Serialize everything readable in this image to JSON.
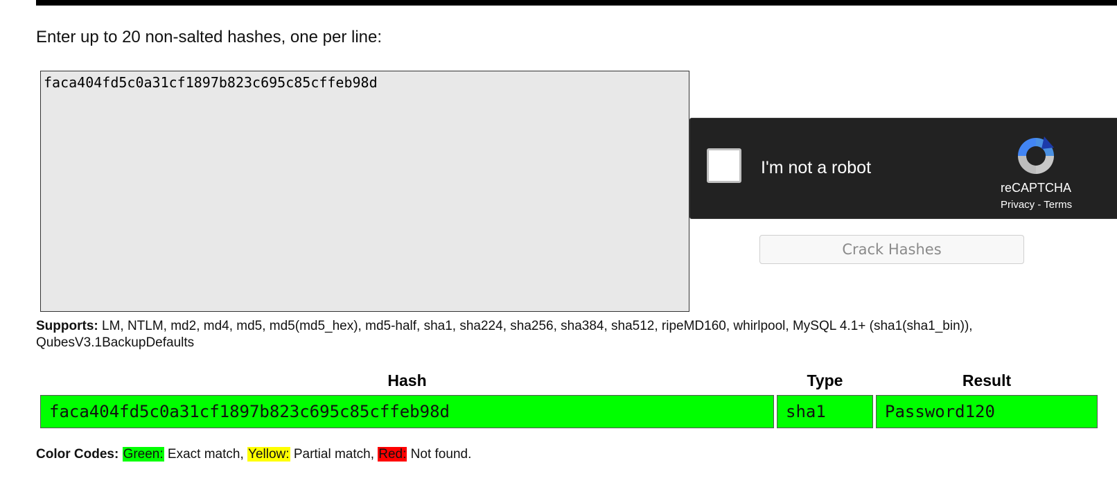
{
  "instructions": "Enter up to 20 non-salted hashes, one per line:",
  "hash_input": {
    "value": "faca404fd5c0a31cf1897b823c695c85cffeb98d"
  },
  "recaptcha": {
    "label": "I'm not a robot",
    "brand": "reCAPTCHA",
    "privacy": "Privacy",
    "separator": " - ",
    "terms": "Terms",
    "logo_icon": "recaptcha-logo-icon"
  },
  "crack_button": "Crack Hashes",
  "supports": {
    "label": "Supports:",
    "text": " LM, NTLM, md2, md4, md5, md5(md5_hex), md5-half, sha1, sha224, sha256, sha384, sha512, ripeMD160, whirlpool, MySQL 4.1+ (sha1(sha1_bin)), QubesV3.1BackupDefaults"
  },
  "results_table": {
    "headers": {
      "hash": "Hash",
      "type": "Type",
      "result": "Result"
    },
    "rows": [
      {
        "hash": "faca404fd5c0a31cf1897b823c695c85cffeb98d",
        "type": "sha1",
        "result": "Password120",
        "status_color": "#00ff00"
      }
    ]
  },
  "color_codes": {
    "label": "Color Codes:",
    "green": "Green:",
    "green_desc": " Exact match, ",
    "yellow": "Yellow:",
    "yellow_desc": " Partial match, ",
    "red": "Red:",
    "red_desc": " Not found.",
    "colors": {
      "green": "#00ff00",
      "yellow": "#ffff00",
      "red": "#ff0000"
    }
  }
}
